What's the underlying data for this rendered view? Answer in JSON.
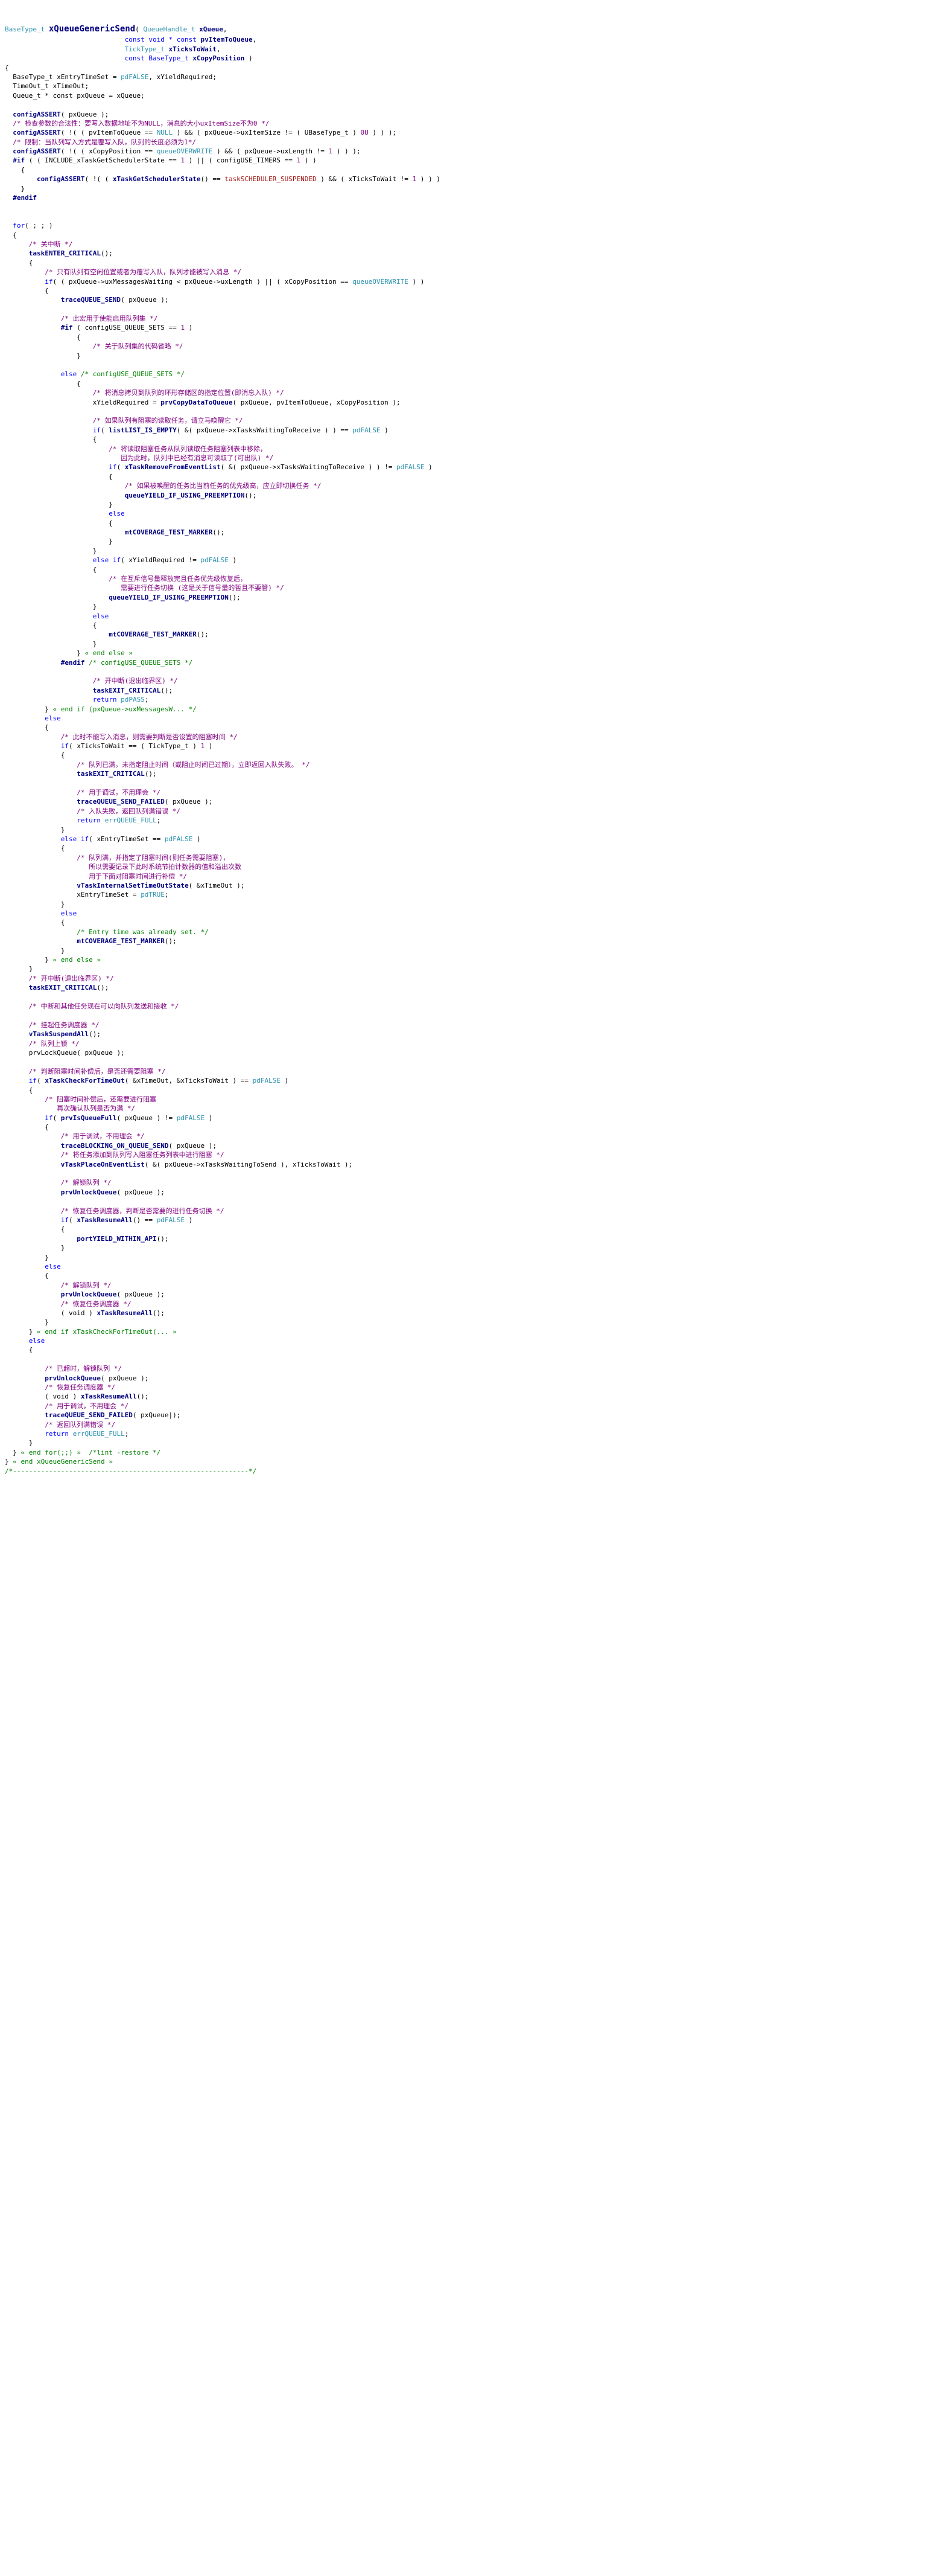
{
  "sig": {
    "ret": "BaseType_t",
    "name": "xQueueGenericSend",
    "p1t": "QueueHandle_t",
    "p1": "xQueue",
    "p2t": "const void * const",
    "p2": "pvItemToQueue",
    "p3t": "TickType_t",
    "p3": "xTicksToWait",
    "p4t": "const BaseType_t",
    "p4": "xCopyPosition"
  },
  "v": {
    "v1": "BaseType_t xEntryTimeSet = ",
    "v1a": "pdFALSE",
    "v1b": ", xYieldRequired;",
    "v2": "TimeOut_t xTimeOut;",
    "v3": "Queue_t * const pxQueue = xQueue;"
  },
  "c": {
    "a1": "configASSERT",
    "a1arg": "( pxQueue );",
    "c1": "/* 检查参数的合法性：要写入数据地址不为NULL，消息的大小uxItemSize不为0 */",
    "a2": "( !( ( pvItemToQueue == ",
    "null": "NULL",
    "a2b": " ) && ( pxQueue->uxItemSize != ( UBaseType_t ) ",
    "zero": "0U",
    "a2c": " ) ) );",
    "c2": "/* 限制：当队列写入方式是覆写入队，队列的长度必须为1*/",
    "a3": "( !( ( xCopyPosition == ",
    "ovr": "queueOVERWRITE",
    "a3b": " ) && ( pxQueue->uxLength != ",
    "one": "1",
    "a3c": " ) ) );",
    "if1": "#if",
    "if1c": "( ( INCLUDE_xTaskGetSchedulerState == ",
    "if1d": " ) || ( configUSE_TIMERS == ",
    "if1e": " ) )",
    "a4a": "( !( ( ",
    "a4fn": "xTaskGetSchedulerState",
    "a4b": "() == ",
    "susp": "taskSCHEDULER_SUSPENDED",
    "a4c": " ) && ( xTicksToWait != ",
    "a4d": " ) ) )",
    "endif": "#endif"
  },
  "loop": {
    "for": "for",
    "forc": "( ; ; )",
    "c1": "/* 关中断 */",
    "enter": "taskENTER_CRITICAL",
    "c2": "/* 只有队列有空闲位置或者为覆写入队，队列才能被写入消息 */",
    "if1": "if",
    "if1a": "( ( pxQueue->uxMessagesWaiting < pxQueue->uxLength ) || ( xCopyPosition == ",
    "if1b": " ) )",
    "trace1": "traceQUEUE_SEND",
    "trace1a": "( pxQueue );",
    "c3": "/* 此宏用于使能启用队列集 */",
    "if2": "#if",
    "if2a": " ( configUSE_QUEUE_SETS == ",
    "if2b": " )",
    "c4": "/* 关于队列集的代码省略 */",
    "else": "else",
    "elsec": " /* configUSE_QUEUE_SETS */",
    "c5": "/* 将消息拷贝到队列的环形存储区的指定位置(即消息入队) */",
    "cp1": "xYieldRequired = ",
    "cpfn": "prvCopyDataToQueue",
    "cp2": "( pxQueue, pvItemToQueue, xCopyPosition );",
    "c6": "/* 如果队列有阻塞的读取任务，请立马唤醒它 */",
    "if3": "if",
    "if3fn": "listLIST_IS_EMPTY",
    "if3a": "( &( pxQueue->xTasksWaitingToReceive ) ) == ",
    "pfalse": "pdFALSE",
    "c7a": "/* 将读取阻塞任务从队列读取任务阻塞列表中移除，",
    "c7b": "   因为此时，队列中已经有消息可读取了(可出队) */",
    "if4": "if",
    "if4fn": "xTaskRemoveFromEventList",
    "if4a": "( &( pxQueue->xTasksWaitingToReceive ) ) != ",
    "c8": "/* 如果被唤醒的任务比当前任务的优先级高，应立即切换任务 */",
    "yield": "queueYIELD_IF_USING_PREEMPTION",
    "cov": "mtCOVERAGE_TEST_MARKER",
    "elif": "else if",
    "elifa": "( xYieldRequired != ",
    "c9a": "/* 在互斥信号量释放完且任务优先级恢复后，",
    "c9b": "   需要进行任务切换 (这是关于信号量的暂且不要管) */",
    "endelse": " « end else »",
    "endifc": "#endif",
    "endifcc": " /* configUSE_QUEUE_SETS */",
    "c10": "/* 开中断(退出临界区) */",
    "exit": "taskEXIT_CRITICAL",
    "ret": "return",
    "ppass": "pdPASS",
    "endif1": " « end if (pxQueue->uxMessagesW... */",
    "c11": "/* 此时不能写入消息，则需要判断是否设置的阻塞时间 */",
    "if5a": "( xTicksToWait == ( TickType_t ) ",
    "c12": "/* 队列已满，未指定阻止时间（或阻止时间已过期），立即返回入队失败。 */",
    "c13": "/* 用于调试，不用理会 */",
    "tracef": "traceQUEUE_SEND_FAILED",
    "tracefa": "( pxQueue );",
    "c14": "/* 入队失败，返回队列满错误 */",
    "errfull": "errQUEUE_FULL",
    "elif2a": "( xEntryTimeSet == ",
    "c15a": "/* 队列满，并指定了阻塞时间(则任务需要阻塞)，",
    "c15b": "   所以需要记录下此时系统节拍计数器的值和溢出次数",
    "c15c": "   用于下面对阻塞时间进行补偿 */",
    "setto": "vTaskInternalSetTimeOutState",
    "settoa": "( &xTimeOut );",
    "set2": "xEntryTimeSet = ",
    "ptrue": "pdTRUE",
    "c16": "/* Entry time was already set. */",
    "c17": "/* 开中断(退出临界区) */",
    "c18": "/* 中断和其他任务现在可以向队列发送和接收 */",
    "c19": "/* 挂起任务调度器 */",
    "susp2": "vTaskSuspendAll",
    "c20": "/* 队列上锁 */",
    "lock": "prvLockQueue",
    "locka": "( pxQueue );",
    "c21": "/* 判断阻塞时间补偿后，是否还需要阻塞 */",
    "chkto": "xTaskCheckForTimeOut",
    "chktoa": "( &xTimeOut, &xTicksToWait ) == ",
    "c22a": "/* 阻塞时间补偿后，还需要进行阻塞",
    "c22b": "   再次确认队列是否为满 */",
    "isfull": "prvIsQueueFull",
    "isfulla": "( pxQueue ) != ",
    "c23": "/* 用于调试，不用理会 */",
    "traceb": "traceBLOCKING_ON_QUEUE_SEND",
    "c24": "/* 将任务添加到队列写入阻塞任务列表中进行阻塞 */",
    "place": "vTaskPlaceOnEventList",
    "placea": "( &( pxQueue->xTasksWaitingToSend ), xTicksToWait );",
    "c25": "/* 解锁队列 */",
    "unlock": "prvUnlockQueue",
    "unlocka": "( pxQueue );",
    "c26": "/* 恢复任务调度器，判断是否需要的进行任务切换 */",
    "resume": "xTaskResumeAll",
    "resumea": "() == ",
    "porty": "portYIELD_WITHIN_API",
    "c27": "/* 解锁队列 */",
    "c28": "/* 恢复任务调度器 */",
    "voidc": "( void ) ",
    "endif2": " « end if xTaskCheckForTimeOut(... »",
    "c29": "/* 已超时，解锁队列 */",
    "c30": "/* 恢复任务调度器 */",
    "c31": "/* 用于调试，不用理会 */",
    "tracefa2": "( pxQueue|);",
    "c32": "/* 返回队列满错误 */",
    "endfor": " « end for(;;) »",
    "lint": "/*lint -restore */",
    "endfn": " « end xQueueGenericSend »",
    "tail": "/*-----------------------------------------------------------*/"
  }
}
